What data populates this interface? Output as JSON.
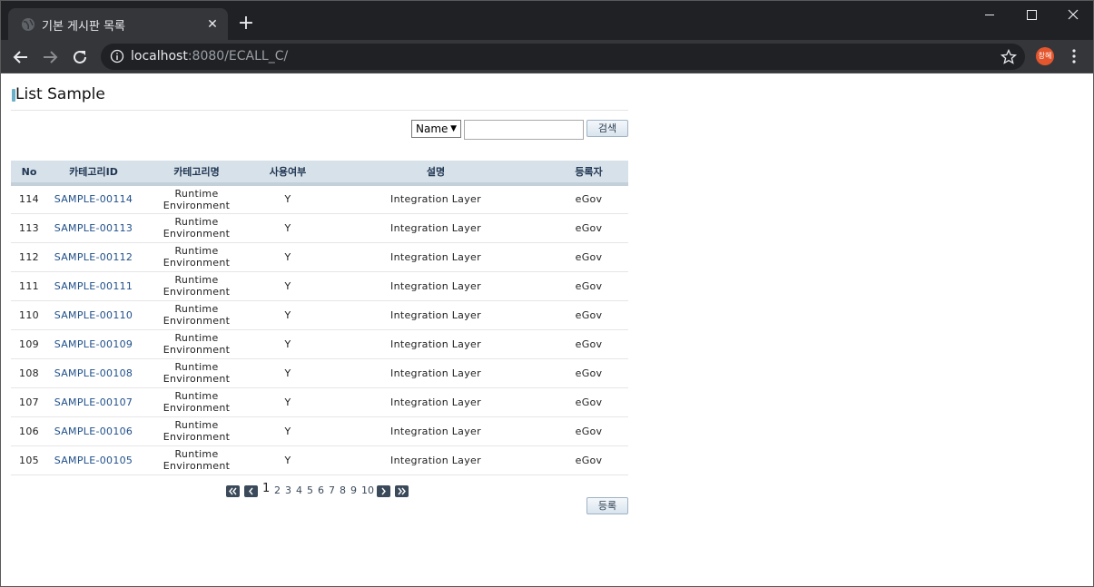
{
  "browser": {
    "tab_title": "기본 게시판 목록",
    "url_host": "localhost",
    "url_rest": ":8080/ECALL_C/",
    "avatar_text": "창혜"
  },
  "page": {
    "title": "List Sample",
    "search": {
      "select_value": "Name",
      "input_value": "",
      "button_label": "검색"
    },
    "table": {
      "headers": [
        "No",
        "카테고리ID",
        "카테고리명",
        "사용여부",
        "설명",
        "등록자"
      ],
      "rows": [
        [
          "114",
          "SAMPLE-00114",
          "Runtime Environment",
          "Y",
          "Integration Layer",
          "eGov"
        ],
        [
          "113",
          "SAMPLE-00113",
          "Runtime Environment",
          "Y",
          "Integration Layer",
          "eGov"
        ],
        [
          "112",
          "SAMPLE-00112",
          "Runtime Environment",
          "Y",
          "Integration Layer",
          "eGov"
        ],
        [
          "111",
          "SAMPLE-00111",
          "Runtime Environment",
          "Y",
          "Integration Layer",
          "eGov"
        ],
        [
          "110",
          "SAMPLE-00110",
          "Runtime Environment",
          "Y",
          "Integration Layer",
          "eGov"
        ],
        [
          "109",
          "SAMPLE-00109",
          "Runtime Environment",
          "Y",
          "Integration Layer",
          "eGov"
        ],
        [
          "108",
          "SAMPLE-00108",
          "Runtime Environment",
          "Y",
          "Integration Layer",
          "eGov"
        ],
        [
          "107",
          "SAMPLE-00107",
          "Runtime Environment",
          "Y",
          "Integration Layer",
          "eGov"
        ],
        [
          "106",
          "SAMPLE-00106",
          "Runtime Environment",
          "Y",
          "Integration Layer",
          "eGov"
        ],
        [
          "105",
          "SAMPLE-00105",
          "Runtime Environment",
          "Y",
          "Integration Layer",
          "eGov"
        ]
      ]
    },
    "pagination": {
      "pages": [
        "1",
        "2",
        "3",
        "4",
        "5",
        "6",
        "7",
        "8",
        "9",
        "10"
      ],
      "current": "1"
    },
    "register_label": "등록"
  }
}
